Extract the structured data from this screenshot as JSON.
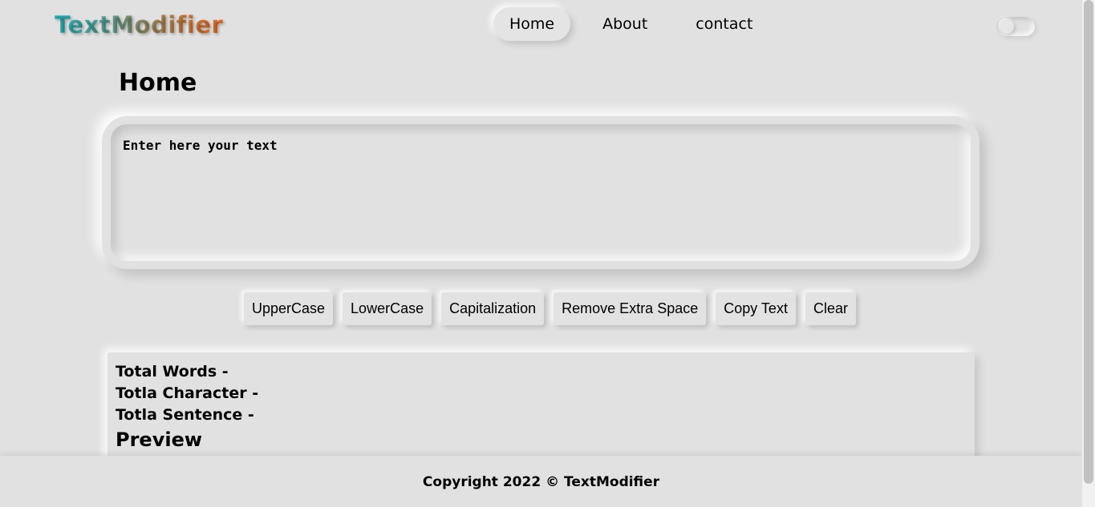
{
  "navbar": {
    "brand": "TextModifier",
    "links": [
      {
        "label": "Home",
        "active": true
      },
      {
        "label": "About",
        "active": false
      },
      {
        "label": "contact",
        "active": false
      }
    ],
    "theme_toggle": {
      "on": false
    }
  },
  "main": {
    "title": "Home",
    "input": {
      "value": "",
      "placeholder": "Enter here your text"
    },
    "buttons": [
      "UpperCase",
      "LowerCase",
      "Capitalization",
      "Remove Extra Space",
      "Copy Text",
      "Clear"
    ]
  },
  "summary": {
    "total_words": "Total Words -",
    "total_characters": "Totla Character -",
    "total_sentences": "Totla Sentence -",
    "preview_title": "Preview"
  },
  "footer": {
    "text": "Copyright 2022 © TextModifier"
  },
  "colors": {
    "background": "#e1e1e1",
    "brand_gradient_start": "#1fb9c4",
    "brand_gradient_end": "#ef6f22"
  }
}
